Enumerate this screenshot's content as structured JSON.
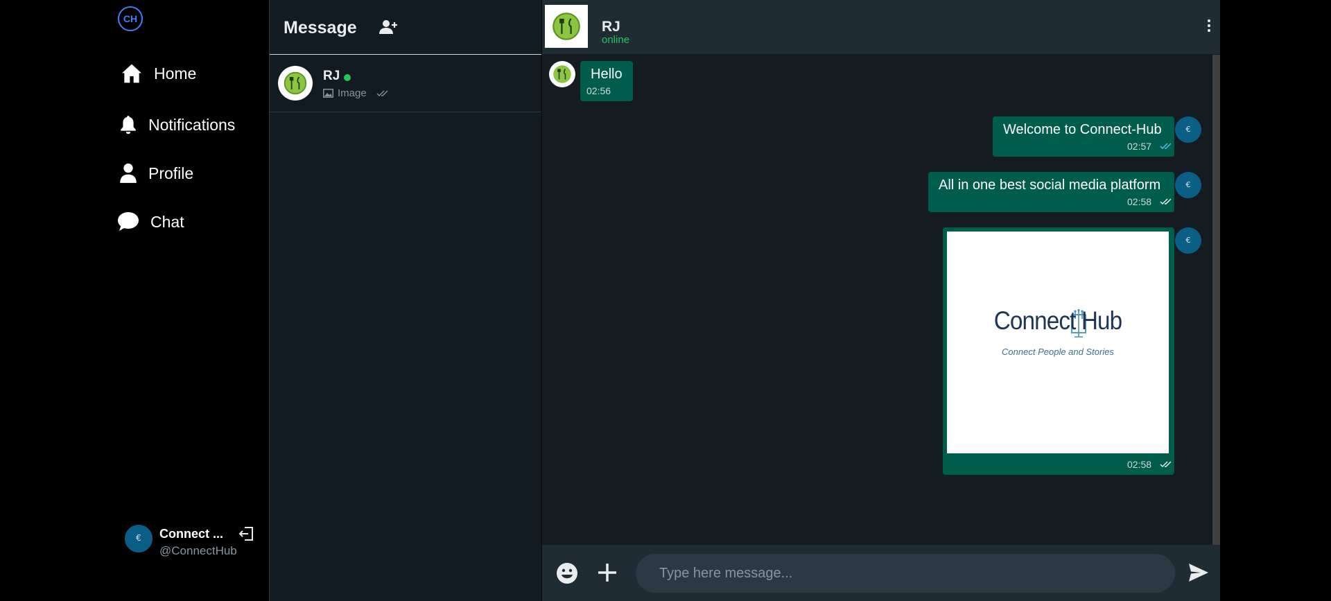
{
  "app": {
    "logo_text": "CH"
  },
  "nav": {
    "home": "Home",
    "notifications": "Notifications",
    "profile": "Profile",
    "chat": "Chat"
  },
  "account": {
    "name": "Connect ...",
    "handle": "@ConnectHub"
  },
  "list": {
    "title": "Message",
    "conversations": [
      {
        "name": "RJ",
        "preview": "Image"
      }
    ]
  },
  "chat": {
    "contact_name": "RJ",
    "status": "online",
    "messages": [
      {
        "text": "Hello",
        "time": "02:56",
        "direction": "incoming"
      },
      {
        "text": "Welcome to Connect-Hub",
        "time": "02:57",
        "direction": "outgoing",
        "read": true
      },
      {
        "text": "All in one best social media platform",
        "time": "02:58",
        "direction": "outgoing",
        "read": false
      },
      {
        "image": {
          "title": "Connect Hub",
          "subtitle": "Connect People and Stories"
        },
        "time": "02:58",
        "direction": "outgoing",
        "read": false
      }
    ],
    "composer": {
      "placeholder": "Type here message..."
    }
  },
  "colors": {
    "bubble": "#005c4b",
    "online": "#22c55e",
    "logo_accent": "#3b82f6",
    "read_tick": "#53bdeb"
  }
}
